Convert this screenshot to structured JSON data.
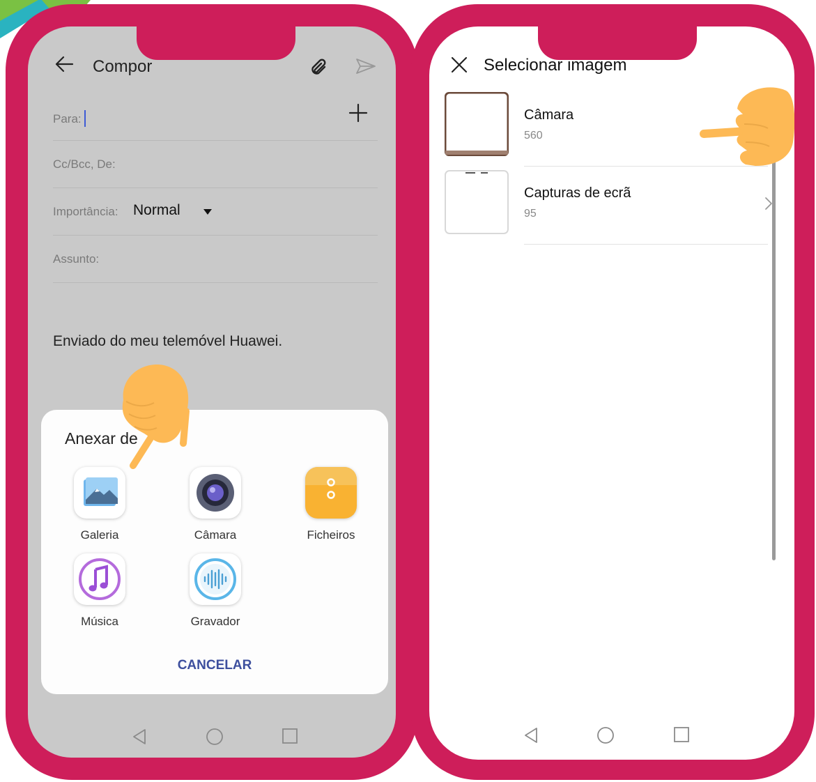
{
  "compose": {
    "title": "Compor",
    "to_label": "Para:",
    "cc_label": "Cc/Bcc, De:",
    "importance_label": "Importância:",
    "importance_value": "Normal",
    "subject_label": "Assunto:",
    "signature": "Enviado do meu telemóvel Huawei."
  },
  "attach_sheet": {
    "title": "Anexar de",
    "options": [
      {
        "label": "Galeria",
        "icon": "gallery-icon"
      },
      {
        "label": "Câmara",
        "icon": "camera-icon"
      },
      {
        "label": "Ficheiros",
        "icon": "files-icon"
      },
      {
        "label": "Música",
        "icon": "music-icon"
      },
      {
        "label": "Gravador",
        "icon": "recorder-icon"
      }
    ],
    "cancel_label": "CANCELAR"
  },
  "select_image": {
    "title": "Selecionar imagem",
    "albums": [
      {
        "name": "Câmara",
        "count": "560"
      },
      {
        "name": "Capturas de ecrã",
        "count": "95"
      }
    ]
  },
  "colors": {
    "frame": "#ce1e5a",
    "hand": "#fdb955",
    "accent": "#3d4f9e"
  }
}
